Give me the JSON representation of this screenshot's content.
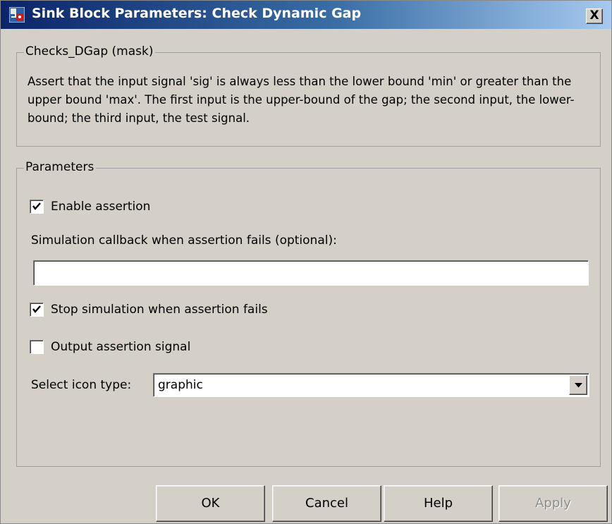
{
  "window": {
    "title": "Sink Block Parameters: Check Dynamic Gap",
    "close_label": "X",
    "title_gradient": [
      "#0a246a",
      "#a6caf0"
    ]
  },
  "description_group": {
    "title": "Checks_DGap (mask)",
    "text": "Assert that the input signal 'sig' is always less than the lower bound 'min' or greater than the upper bound 'max'.  The first input is the upper-bound of the gap; the second input, the lower-bound; the third input, the test signal."
  },
  "parameters": {
    "title": "Parameters",
    "enable_assertion": {
      "label": "Enable assertion",
      "checked": true
    },
    "callback_label": "Simulation callback when assertion fails (optional):",
    "callback_value": "",
    "stop_simulation": {
      "label": "Stop simulation when assertion fails",
      "checked": true
    },
    "output_signal": {
      "label": "Output assertion signal",
      "checked": false
    },
    "icon_type_label": "Select icon type:",
    "icon_type_value": "graphic"
  },
  "buttons": {
    "ok": "OK",
    "cancel": "Cancel",
    "help": "Help",
    "apply": "Apply"
  },
  "icons": {
    "app": "simulink-block-icon",
    "close": "close-icon",
    "check": "checkmark-icon",
    "dropdown": "chevron-down-icon"
  }
}
